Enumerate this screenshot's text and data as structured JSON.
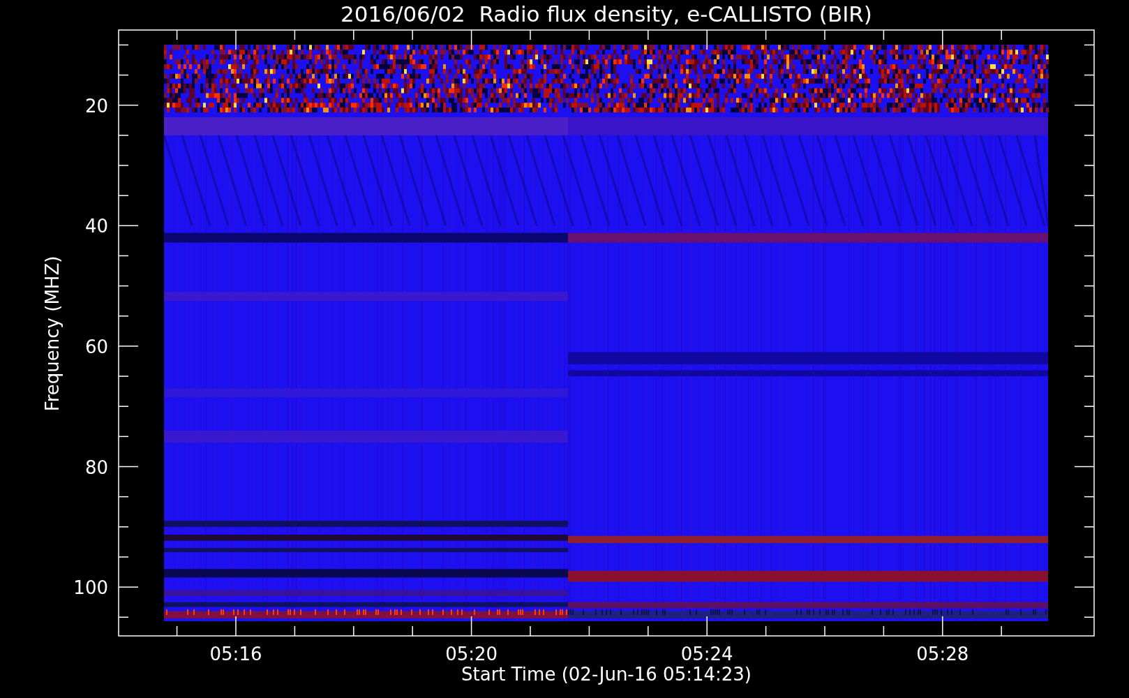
{
  "plot": {
    "title": "2016/06/02  Radio flux density, e-CALLISTO (BIR)",
    "xlabel": "Start Time (02-Jun-16 05:14:23)",
    "ylabel": "Frequency (MHZ)",
    "xtick_labels": [
      "05:16",
      "05:20",
      "05:24",
      "05:28"
    ],
    "ytick_labels": [
      "20",
      "40",
      "60",
      "80",
      "100"
    ]
  }
}
